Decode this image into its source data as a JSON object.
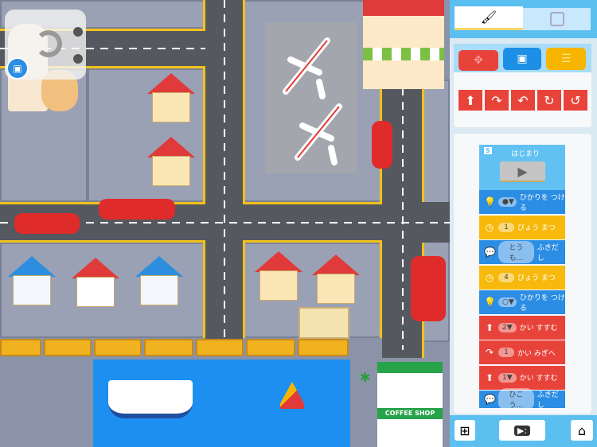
{
  "map": {
    "shop_sign": "COFFEE SHOP"
  },
  "overlay": {
    "icons": [
      "robot-wifi-icon",
      "rotate-icon"
    ]
  },
  "panel": {
    "tabs": [
      {
        "icon": "paintbrush-icon",
        "active": true
      },
      {
        "icon": "robot-face-icon",
        "active": false
      }
    ],
    "categories": [
      {
        "icon": "move-arrows-icon",
        "color": "#e8433a"
      },
      {
        "icon": "robot-light-icon",
        "color": "#1e8fe6"
      },
      {
        "icon": "flow-blocks-icon",
        "color": "#f7b500"
      }
    ],
    "palette": [
      "forward-arrow-icon",
      "turn-right-icon",
      "turn-left-icon",
      "rotate-right-icon",
      "rotate-left-icon"
    ],
    "program": {
      "start_badge": "S",
      "start_label": "はじまり",
      "blocks": [
        {
          "type": "light",
          "icon": "bulb-icon",
          "value": "●▼",
          "label": "ひかりを つける",
          "color": "#2b8de3"
        },
        {
          "type": "wait",
          "icon": "clock-icon",
          "value": "1",
          "label": "びょう まつ",
          "color": "#f7b90c"
        },
        {
          "type": "speech",
          "icon": "speech-icon",
          "value": "とうも...",
          "label": "ふきだし",
          "color": "#2b8de3"
        },
        {
          "type": "wait",
          "icon": "clock-icon",
          "value": "4",
          "label": "びょう まつ",
          "color": "#f7b90c"
        },
        {
          "type": "light",
          "icon": "bulb-icon",
          "value": "○▼",
          "label": "ひかりを つける",
          "color": "#2b8de3"
        },
        {
          "type": "move",
          "icon": "forward-arrow-icon",
          "value": "2▼",
          "label": "かい すすむ",
          "color": "#e8433a"
        },
        {
          "type": "turn",
          "icon": "turn-right-icon",
          "value": "1",
          "label": "かい みぎへ",
          "color": "#e8433a"
        },
        {
          "type": "move",
          "icon": "forward-arrow-icon",
          "value": "1▼",
          "label": "かい すすむ",
          "color": "#e8433a"
        },
        {
          "type": "speech",
          "icon": "speech-icon",
          "value": "ひこう...",
          "label": "ふきだし",
          "color": "#2b8de3"
        }
      ]
    },
    "bottom": [
      "grid-icon",
      "video-play-icon",
      "home-icon"
    ]
  }
}
